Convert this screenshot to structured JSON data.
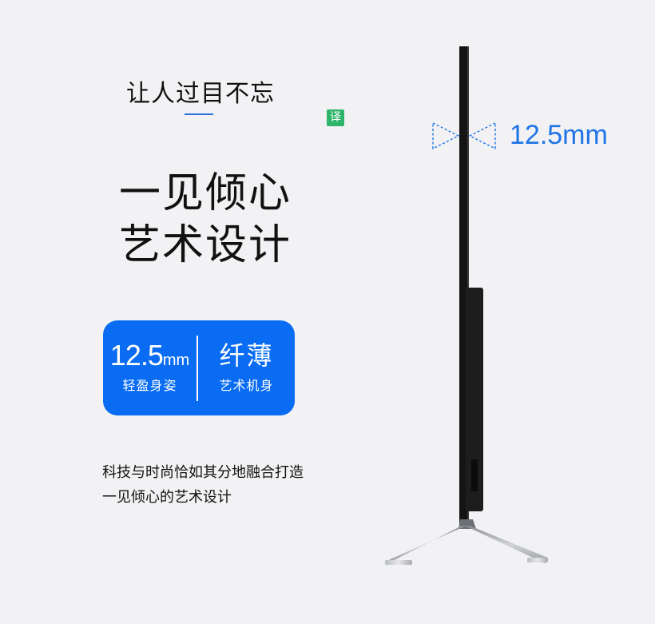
{
  "promo": {
    "tagline": "让人过目不忘",
    "translate_badge": "译",
    "headline": [
      "一见倾心",
      "艺术设计"
    ],
    "spec_card": {
      "thickness_value": "12.5",
      "thickness_unit": "mm",
      "thickness_caption": "轻盈身姿",
      "slim_title": "纤薄",
      "slim_caption": "艺术机身"
    },
    "body_text": [
      "科技与时尚恰如其分地融合打造",
      "一见倾心的艺术设计"
    ]
  },
  "product_image": {
    "measure_label": "12.5mm",
    "measure_color": "#1f74e6"
  },
  "colors": {
    "background": "#f2f2f4",
    "accent_blue": "#0a6cf2",
    "translate_green": "#2fb56a"
  }
}
